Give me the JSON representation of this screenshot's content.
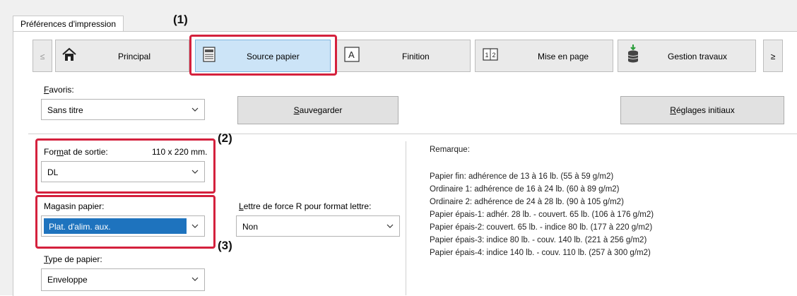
{
  "window": {
    "tab_title": "Préférences d'impression"
  },
  "callouts": {
    "c1": "(1)",
    "c2": "(2)",
    "c3": "(3)"
  },
  "tabs": {
    "prev": "≤",
    "next": "≥",
    "items": [
      {
        "label": "Principal",
        "icon": "home-icon"
      },
      {
        "label": "Source papier",
        "icon": "printer-tray-icon",
        "selected": true
      },
      {
        "label": "Finition",
        "icon": "letter-a-icon"
      },
      {
        "label": "Mise en page",
        "icon": "layout-12-icon"
      },
      {
        "label": "Gestion travaux",
        "icon": "database-download-icon"
      }
    ]
  },
  "favorites": {
    "label": "Favoris:",
    "value": "Sans titre",
    "save_button": "Sauvegarder",
    "reset_button": "Réglages initiaux"
  },
  "output_size": {
    "label": "Format de sortie:",
    "dimension": "110 x 220 mm.",
    "value": "DL"
  },
  "paper_tray": {
    "label": "Magasin papier:",
    "value": "Plat. d'alim. aux."
  },
  "force_letter": {
    "label": "Lettre de force R pour format lettre:",
    "value": "Non"
  },
  "paper_type": {
    "label": "Type de papier:",
    "value": "Enveloppe"
  },
  "remarks": {
    "title": "Remarque:",
    "lines": [
      "Papier fin: adhérence de 13 à 16 lb. (55 à 59 g/m2)",
      "Ordinaire 1: adhérence de 16 à 24 lb. (60 à 89 g/m2)",
      "Ordinaire 2: adhérence de 24 à 28 lb. (90 à 105 g/m2)",
      "Papier épais-1: adhér. 28 lb. - couvert. 65 lb. (106 à 176 g/m2)",
      "Papier épais-2: couvert. 65 lb. - indice 80 lb. (177 à 220 g/m2)",
      "Papier épais-3: indice 80 lb. - couv. 140 lb. (221 à 256 g/m2)",
      "Papier épais-4: indice 140 lb. - couv. 110 lb. (257 à 300 g/m2)"
    ]
  },
  "colors": {
    "selected_tab": "#cce4f7",
    "callout_border": "#d4213d",
    "selected_combo": "#1e73be"
  }
}
